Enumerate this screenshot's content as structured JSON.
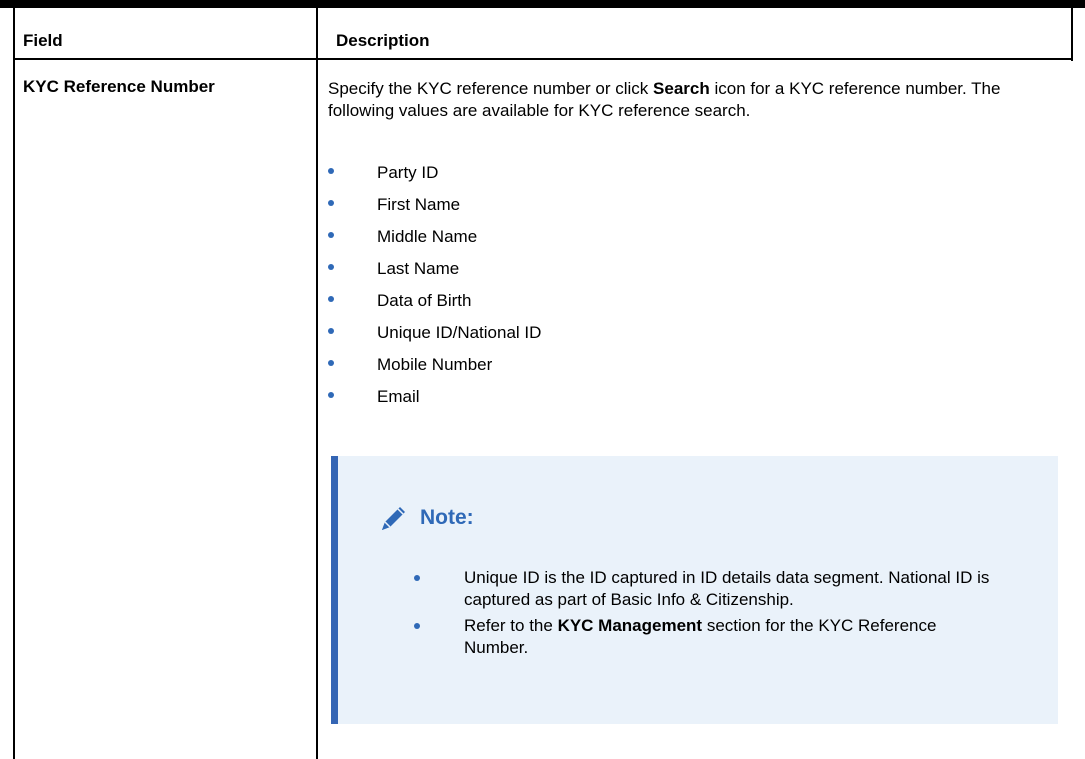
{
  "table": {
    "headers": {
      "field": "Field",
      "description": "Description"
    },
    "row": {
      "field": "KYC Reference Number",
      "description_parts": {
        "before": "Specify the KYC reference number or click ",
        "bold": "Search",
        "after": " icon for a KYC reference number. The following values are available for KYC reference search."
      },
      "options": [
        "Party ID",
        "First Name",
        "Middle Name",
        "Last Name",
        "Data of Birth",
        "Unique ID/National ID",
        "Mobile Number",
        "Email"
      ]
    }
  },
  "note": {
    "title": "Note:",
    "icon": "pencil-icon",
    "items": [
      {
        "text": "Unique ID is the ID captured in ID details data segment. National ID is captured as part of Basic Info & Citizenship."
      },
      {
        "before": "Refer to the ",
        "bold": "KYC Management",
        "after": " section for the KYC Reference Number."
      }
    ]
  },
  "colors": {
    "accent": "#2f69b7",
    "note_background": "#eaf2fa",
    "note_border": "#3465b4"
  }
}
